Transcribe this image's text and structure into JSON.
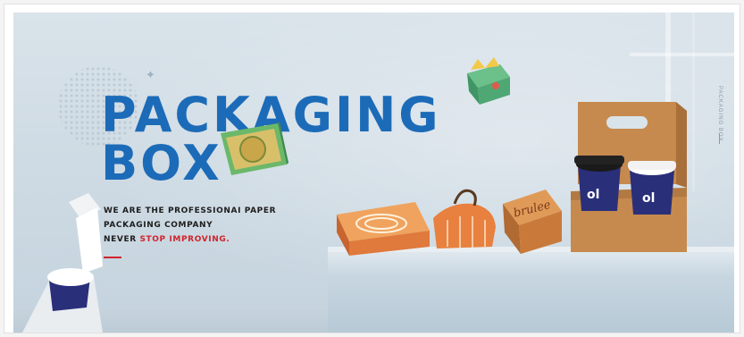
{
  "banner": {
    "title_line1": "PACKAGING",
    "title_line2": "BOX",
    "tagline_line1": "WE ARE THE PROFESSIONAI PAPER",
    "tagline_line2": "PACKAGING COMPANY",
    "tagline_line3_prefix": "NEVER",
    "tagline_line3_highlight": "STOP IMPROVING.",
    "side_text": "PACKAGING BOX",
    "sparkle_glyph": "✦"
  },
  "products": {
    "box_label": "brulee",
    "cup_label": "ol"
  },
  "colors": {
    "title_blue": "#1c6bb8",
    "accent_red": "#d0232b",
    "kraft": "#c68a4e",
    "orange": "#e0793c",
    "cup_navy": "#2a2f7a"
  }
}
